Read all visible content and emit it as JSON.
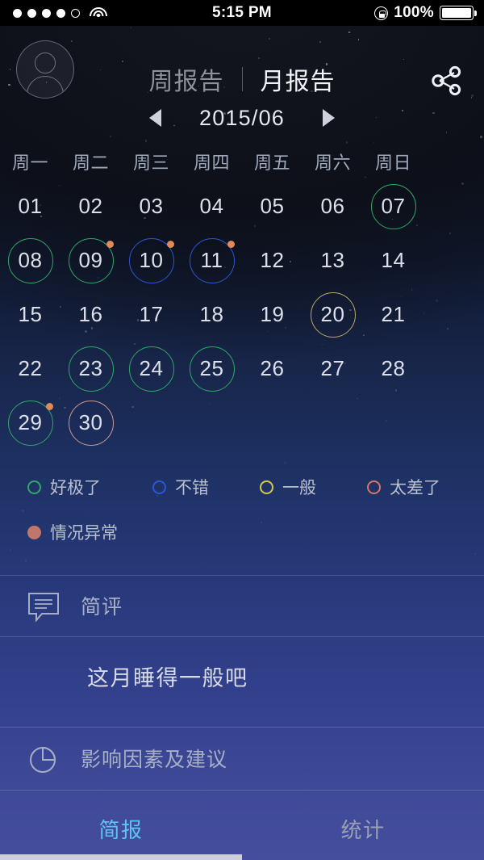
{
  "status_bar": {
    "signal_dots_filled": 4,
    "signal_dots_total": 5,
    "wifi_icon": "wifi-icon",
    "time": "5:15 PM",
    "rotation_lock_icon": "rotation-lock-icon",
    "battery_percent": "100%",
    "battery_level": 100
  },
  "header": {
    "avatar_icon": "avatar-icon",
    "tab_week": "周报告",
    "tab_month": "月报告",
    "active_tab": "月报告",
    "share_icon": "share-icon"
  },
  "month_nav": {
    "prev_icon": "chevron-left-icon",
    "label": "2015/06",
    "next_icon": "chevron-right-icon"
  },
  "calendar": {
    "weekday_headers": [
      "周一",
      "周二",
      "周三",
      "周四",
      "周五",
      "周六",
      "周日"
    ],
    "weeks": [
      [
        {
          "day": "01",
          "ring": null,
          "dot": false
        },
        {
          "day": "02",
          "ring": null,
          "dot": false
        },
        {
          "day": "03",
          "ring": null,
          "dot": false
        },
        {
          "day": "04",
          "ring": null,
          "dot": false
        },
        {
          "day": "05",
          "ring": null,
          "dot": false
        },
        {
          "day": "06",
          "ring": null,
          "dot": false
        },
        {
          "day": "07",
          "ring": "green",
          "dot": false
        }
      ],
      [
        {
          "day": "08",
          "ring": "green",
          "dot": false
        },
        {
          "day": "09",
          "ring": "green",
          "dot": true
        },
        {
          "day": "10",
          "ring": "blue",
          "dot": true
        },
        {
          "day": "11",
          "ring": "blue",
          "dot": true
        },
        {
          "day": "12",
          "ring": null,
          "dot": false
        },
        {
          "day": "13",
          "ring": null,
          "dot": false
        },
        {
          "day": "14",
          "ring": null,
          "dot": false
        }
      ],
      [
        {
          "day": "15",
          "ring": null,
          "dot": false
        },
        {
          "day": "16",
          "ring": null,
          "dot": false
        },
        {
          "day": "17",
          "ring": null,
          "dot": false
        },
        {
          "day": "18",
          "ring": null,
          "dot": false
        },
        {
          "day": "19",
          "ring": null,
          "dot": false
        },
        {
          "day": "20",
          "ring": "yellow",
          "dot": false
        },
        {
          "day": "21",
          "ring": null,
          "dot": false
        }
      ],
      [
        {
          "day": "22",
          "ring": null,
          "dot": false
        },
        {
          "day": "23",
          "ring": "green",
          "dot": false
        },
        {
          "day": "24",
          "ring": "green",
          "dot": false
        },
        {
          "day": "25",
          "ring": "green",
          "dot": false
        },
        {
          "day": "26",
          "ring": null,
          "dot": false
        },
        {
          "day": "27",
          "ring": null,
          "dot": false
        },
        {
          "day": "28",
          "ring": null,
          "dot": false
        }
      ],
      [
        {
          "day": "29",
          "ring": "green",
          "dot": true
        },
        {
          "day": "30",
          "ring": "red",
          "dot": false
        },
        {
          "day": "",
          "ring": null,
          "dot": false
        },
        {
          "day": "",
          "ring": null,
          "dot": false
        },
        {
          "day": "",
          "ring": null,
          "dot": false
        },
        {
          "day": "",
          "ring": null,
          "dot": false
        },
        {
          "day": "",
          "ring": null,
          "dot": false
        }
      ]
    ]
  },
  "legend": {
    "items": [
      {
        "label": "好极了",
        "color": "#2fa866",
        "style": "ring"
      },
      {
        "label": "不错",
        "color": "#2a57d6",
        "style": "ring"
      },
      {
        "label": "一般",
        "color": "#d4c84b",
        "style": "ring"
      },
      {
        "label": "太差了",
        "color": "#d8736a",
        "style": "ring"
      },
      {
        "label": "情况异常",
        "color": "#c0766a",
        "style": "fill"
      }
    ]
  },
  "sections": {
    "comment": {
      "icon": "comment-bubble-icon",
      "title": "简评",
      "text": "这月睡得一般吧"
    },
    "factors": {
      "icon": "pie-chart-icon",
      "title": "影响因素及建议"
    }
  },
  "bottom_tabs": {
    "items": [
      {
        "label": "简报",
        "active": true
      },
      {
        "label": "统计",
        "active": false
      }
    ],
    "active_color": "#5ec4ef",
    "inactive_color": "#9aa1b7"
  },
  "ring_colors": {
    "green": "#2fa866",
    "blue": "#2a57d6",
    "yellow": "#b5a963",
    "red": "#c99b92",
    "dot": "#e08a5c"
  }
}
